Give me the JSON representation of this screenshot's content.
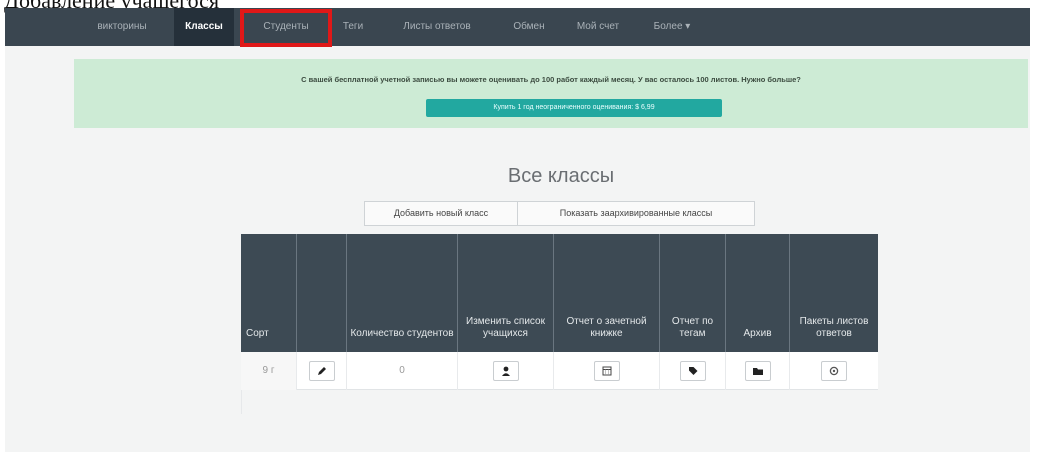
{
  "clipped_top_text": "Добавление учащегося",
  "nav": {
    "items": [
      {
        "label": "викторины",
        "active": false
      },
      {
        "label": "Классы",
        "active": true
      },
      {
        "label": "Студенты",
        "active": false
      },
      {
        "label": "Теги",
        "active": false
      },
      {
        "label": "Листы ответов",
        "active": false
      },
      {
        "label": "Обмен",
        "active": false
      },
      {
        "label": "Мой счет",
        "active": false
      },
      {
        "label": "Более ▾",
        "active": false
      }
    ]
  },
  "banner": {
    "text": "С вашей бесплатной учетной записью вы можете оценивать до 100 работ каждый месяц. У вас осталось 100 листов. Нужно больше?",
    "button": "Купить 1 год неограниченного оценивания: $ 6,99"
  },
  "page_title": "Все классы",
  "buttons": {
    "add_class": "Добавить новый класс",
    "show_archived": "Показать заархивированные классы"
  },
  "table": {
    "headers": [
      "Сорт",
      "",
      "Количество студентов",
      "Изменить список учащихся",
      "Отчет о зачетной книжке",
      "Отчет по тегам",
      "Архив",
      "Пакеты листов ответов"
    ],
    "row": {
      "sort": "9 г",
      "student_count": "0"
    }
  },
  "colors": {
    "navbar": "#3a4650",
    "highlight": "#e01818",
    "banner": "#cdebd5",
    "accent_button": "#22a8a0",
    "table_header": "#3d4a54"
  }
}
